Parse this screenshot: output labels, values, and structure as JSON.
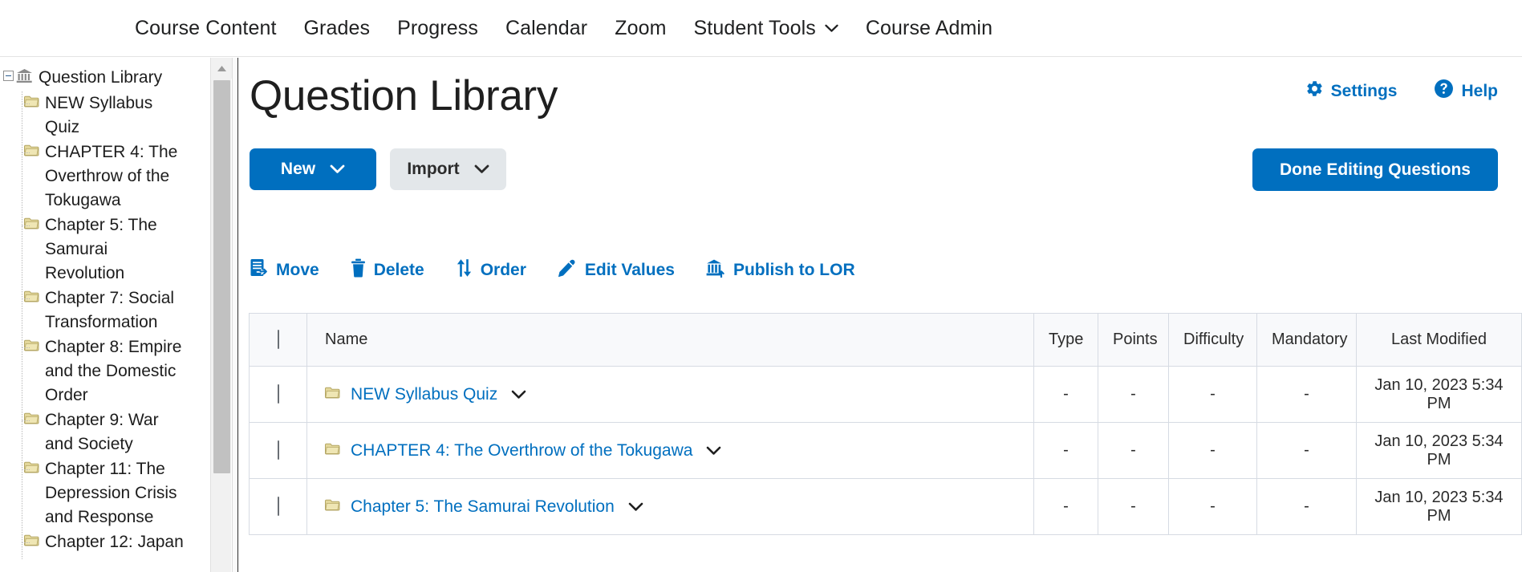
{
  "topnav": {
    "items": [
      {
        "label": "Course Content",
        "has_caret": false
      },
      {
        "label": "Grades",
        "has_caret": false
      },
      {
        "label": "Progress",
        "has_caret": false
      },
      {
        "label": "Calendar",
        "has_caret": false
      },
      {
        "label": "Zoom",
        "has_caret": false
      },
      {
        "label": "Student Tools",
        "has_caret": true
      },
      {
        "label": "Course Admin",
        "has_caret": false
      }
    ]
  },
  "sidebar": {
    "root": {
      "label": "Question Library",
      "icon": "library-bank-icon",
      "expander": "collapse-minus-icon"
    },
    "items": [
      {
        "label": "NEW Syllabus Quiz",
        "icon": "folder-icon"
      },
      {
        "label": "CHAPTER 4: The Overthrow of the Tokugawa",
        "icon": "folder-icon"
      },
      {
        "label": "Chapter 5: The Samurai Revolution",
        "icon": "folder-icon"
      },
      {
        "label": "Chapter 7: Social Transformation",
        "icon": "folder-icon"
      },
      {
        "label": "Chapter 8: Empire and the Domestic Order",
        "icon": "folder-icon"
      },
      {
        "label": "Chapter 9: War and Society",
        "icon": "folder-icon"
      },
      {
        "label": "Chapter 11: The Depression Crisis and Response",
        "icon": "folder-icon"
      },
      {
        "label": "Chapter 12: Japan",
        "icon": "folder-icon"
      }
    ],
    "scrollbar": {
      "up_arrow_icon": "scroll-up-arrow-icon"
    }
  },
  "header": {
    "title": "Question Library",
    "links": [
      {
        "label": "Settings",
        "icon": "gear-icon"
      },
      {
        "label": "Help",
        "icon": "help-question-circle-icon"
      }
    ]
  },
  "actions": {
    "new_label": "New",
    "new_caret": "chevron-down-icon",
    "import_label": "Import",
    "import_caret": "chevron-down-icon",
    "done_label": "Done Editing Questions"
  },
  "toolbar": {
    "items": [
      {
        "label": "Move",
        "icon": "move-document-icon"
      },
      {
        "label": "Delete",
        "icon": "trash-icon"
      },
      {
        "label": "Order",
        "icon": "order-arrows-icon"
      },
      {
        "label": "Edit Values",
        "icon": "pencil-icon"
      },
      {
        "label": "Publish to LOR",
        "icon": "publish-building-icon"
      }
    ]
  },
  "table": {
    "select_all_checkbox": "select-all-checkbox",
    "columns": [
      "Name",
      "Type",
      "Points",
      "Difficulty",
      "Mandatory",
      "Last Modified"
    ],
    "rows": [
      {
        "name": "NEW Syllabus Quiz",
        "icon": "folder-icon",
        "caret": "chevron-down-icon",
        "type": "-",
        "points": "-",
        "difficulty": "-",
        "mandatory": "-",
        "last_modified": "Jan 10, 2023 5:34 PM"
      },
      {
        "name": "CHAPTER 4: The Overthrow of the Tokugawa",
        "icon": "folder-icon",
        "caret": "chevron-down-icon",
        "type": "-",
        "points": "-",
        "difficulty": "-",
        "mandatory": "-",
        "last_modified": "Jan 10, 2023 5:34 PM"
      },
      {
        "name": "Chapter 5: The Samurai Revolution",
        "icon": "folder-icon",
        "caret": "chevron-down-icon",
        "type": "-",
        "points": "-",
        "difficulty": "-",
        "mandatory": "-",
        "last_modified": "Jan 10, 2023 5:34 PM"
      }
    ]
  },
  "colors": {
    "accent_blue": "#006fbf",
    "link_blue": "#006fbf",
    "button_secondary": "#e3e7ea",
    "folder_yellow": "#ddd08a",
    "text_dark": "#1f1f1f",
    "table_header_bg": "#f8f9fb",
    "table_border": "#d6dbe3"
  }
}
